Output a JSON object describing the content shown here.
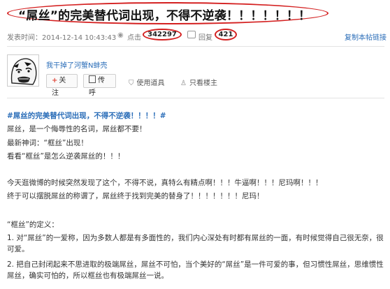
{
  "header": {
    "title": "“屌丝”的完美替代词出现，不得不逆袭！！！！！！！",
    "publish_label": "发表时间：2014-12-14 10:43:43",
    "views_label": "点击",
    "views_count": "342297",
    "replies_label": "回复",
    "replies_count": "421",
    "copy_link": "复制本帖链接"
  },
  "author": {
    "name": "我干掉了河蟹N蚌壳",
    "follow_label": "关注",
    "share_label": "传呼",
    "items_label": "使用道具",
    "only_author_label": "只看楼主"
  },
  "post": {
    "tag": "#屌丝的完美替代词出现，不得不逆袭！！！！#",
    "lines": [
      "屌丝，是一个侮辱性的名词，屌丝都不要！",
      "最新神词：“框丝”出现！",
      "看看“框丝”是怎么逆袭屌丝的！！！",
      "今天逛微博的时候突然发现了这个，不得不说，真特么有精点啊！！！牛逼啊！！！尼玛啊！！！",
      "终于可以摆脱屌丝的称谓了，屌丝终于找到完美的替身了！！！！！！！尼玛！",
      "“框丝”的定义：",
      "1. 对“屌丝”的一爱称，因为多数人都是有多面性的，我们内心深处有时都有屌丝的一面，有时候觉得自己很无奈，很可爱。",
      "2. 把自己封闭起来不思进取的极端屌丝，屌丝不可怕，当个美好的“屌丝”是一件可爱的事，但习惯性屌丝，思维惯性屌丝，确实可怕的，所以框丝也有极端屌丝一说。"
    ]
  },
  "icons": {
    "views": "eye-icon",
    "replies": "comment-icon",
    "items": "toolbox-icon",
    "only_author": "person-icon",
    "share": "pager-icon"
  },
  "colors": {
    "annotation_red": "#d42020",
    "link_blue": "#2a6db8"
  }
}
